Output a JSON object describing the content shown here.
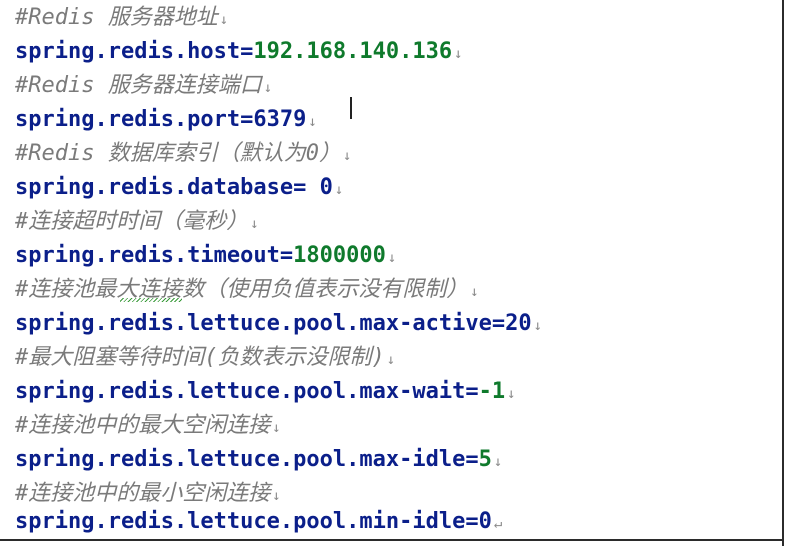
{
  "lines": [
    {
      "type": "comment",
      "text": "#Redis 服务器地址",
      "mark": "↓"
    },
    {
      "type": "code",
      "key": "spring.redis.host=",
      "value": "192.168.140.136",
      "mark": "↓"
    },
    {
      "type": "comment",
      "text": "#Redis 服务器连接端口",
      "mark": "↓"
    },
    {
      "type": "code",
      "key": "spring.redis.port=",
      "value": "6379",
      "mark": "↓"
    },
    {
      "type": "comment",
      "text": "#Redis 数据库索引（默认为0）",
      "mark": "↓"
    },
    {
      "type": "code",
      "key": "spring.redis.database= ",
      "value": "0",
      "mark": "↓"
    },
    {
      "type": "comment",
      "text": "#连接超时时间（毫秒）",
      "mark": "↓"
    },
    {
      "type": "code",
      "key": "spring.redis.timeout=",
      "value": "1800000",
      "mark": "↓"
    },
    {
      "type": "comment",
      "text": "#连接池最大连接数（使用负值表示没有限制）",
      "mark": "↓"
    },
    {
      "type": "code",
      "key": "spring.redis.lettuce.pool.max-active=",
      "value": "20",
      "mark": "↓"
    },
    {
      "type": "comment",
      "text": "#最大阻塞等待时间(负数表示没限制)",
      "mark": "↓"
    },
    {
      "type": "code",
      "key": "spring.redis.lettuce.pool.max-wait=",
      "value": "-1",
      "mark": "↓"
    },
    {
      "type": "comment",
      "text": "#连接池中的最大空闲连接",
      "mark": "↓"
    },
    {
      "type": "code",
      "key": "spring.redis.lettuce.pool.max-idle=",
      "value": "5",
      "mark": "↓"
    },
    {
      "type": "comment",
      "text": "#连接池中的最小空闲连接",
      "mark": "↓"
    },
    {
      "type": "code",
      "key": "spring.redis.lettuce.pool.min-idle=",
      "value": "0",
      "mark": "↵"
    }
  ],
  "colors": {
    "comment": "#7a7a7a",
    "key": "#0b1f8a",
    "value_green": "#0f7a2c",
    "value_blue": "#0b1f8a"
  }
}
